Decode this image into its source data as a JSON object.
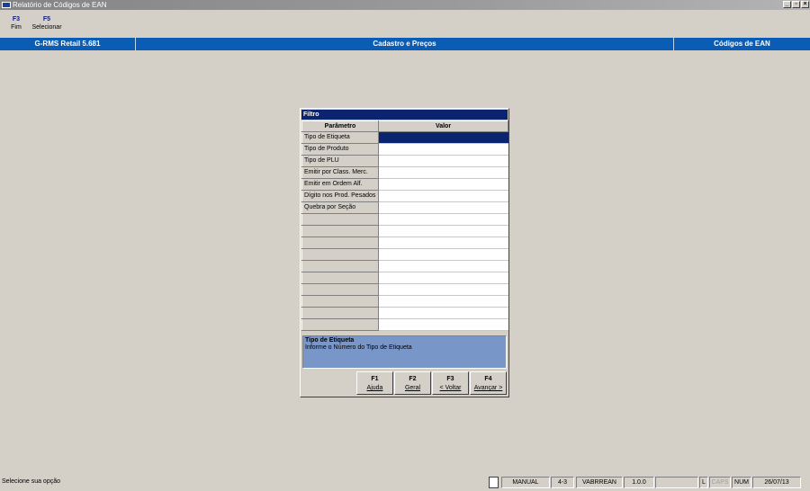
{
  "window": {
    "title": "Relatório de Códigos de EAN",
    "minimize": "_",
    "maximize": "▫",
    "close": "×"
  },
  "toolbar": {
    "items": [
      {
        "key": "F3",
        "label": "Fim"
      },
      {
        "key": "F5",
        "label": "Selecionar"
      }
    ]
  },
  "header": {
    "left": "G-RMS Retail 5.681",
    "center": "Cadastro e Preços",
    "right": "Códigos de EAN"
  },
  "dialog": {
    "title": "Filtro",
    "columns": {
      "param": "Parâmetro",
      "value": "Valor"
    },
    "rows": [
      {
        "param": "Tipo de Etiqueta",
        "value": ""
      },
      {
        "param": "Tipo de Produto",
        "value": ""
      },
      {
        "param": "Tipo de PLU",
        "value": ""
      },
      {
        "param": "Emitir por Class. Merc.",
        "value": ""
      },
      {
        "param": "Emitir em Ordem Alf.",
        "value": ""
      },
      {
        "param": "Dígito nos Prod. Pesados",
        "value": ""
      },
      {
        "param": "Quebra por Seção",
        "value": ""
      }
    ],
    "empty_rows": 10,
    "selected_row": 0,
    "help": {
      "title": "Tipo de Etiqueta",
      "text": "Informe o Número do Tipo de Etiqueta"
    },
    "buttons": [
      {
        "key": "F1",
        "label": "Ajuda"
      },
      {
        "key": "F2",
        "label": "Geral"
      },
      {
        "key": "F3",
        "label": "< Voltar"
      },
      {
        "key": "F4",
        "label": "Avançar >"
      }
    ]
  },
  "status": {
    "message": "Selecione sua opção",
    "mode": "MANUAL",
    "code": "4-3",
    "program": "VABRREAN",
    "version": "1.0.0",
    "blank": "",
    "l": "L",
    "caps": "CAPS",
    "num": "NUM",
    "date": "26/07/13"
  },
  "colors": {
    "header_bg": "#0a5cb4",
    "dialog_title_bg": "#0a2470",
    "selected_value_bg": "#0a2470",
    "help_bg": "#7896c8",
    "window_bg": "#d4d0c8"
  }
}
